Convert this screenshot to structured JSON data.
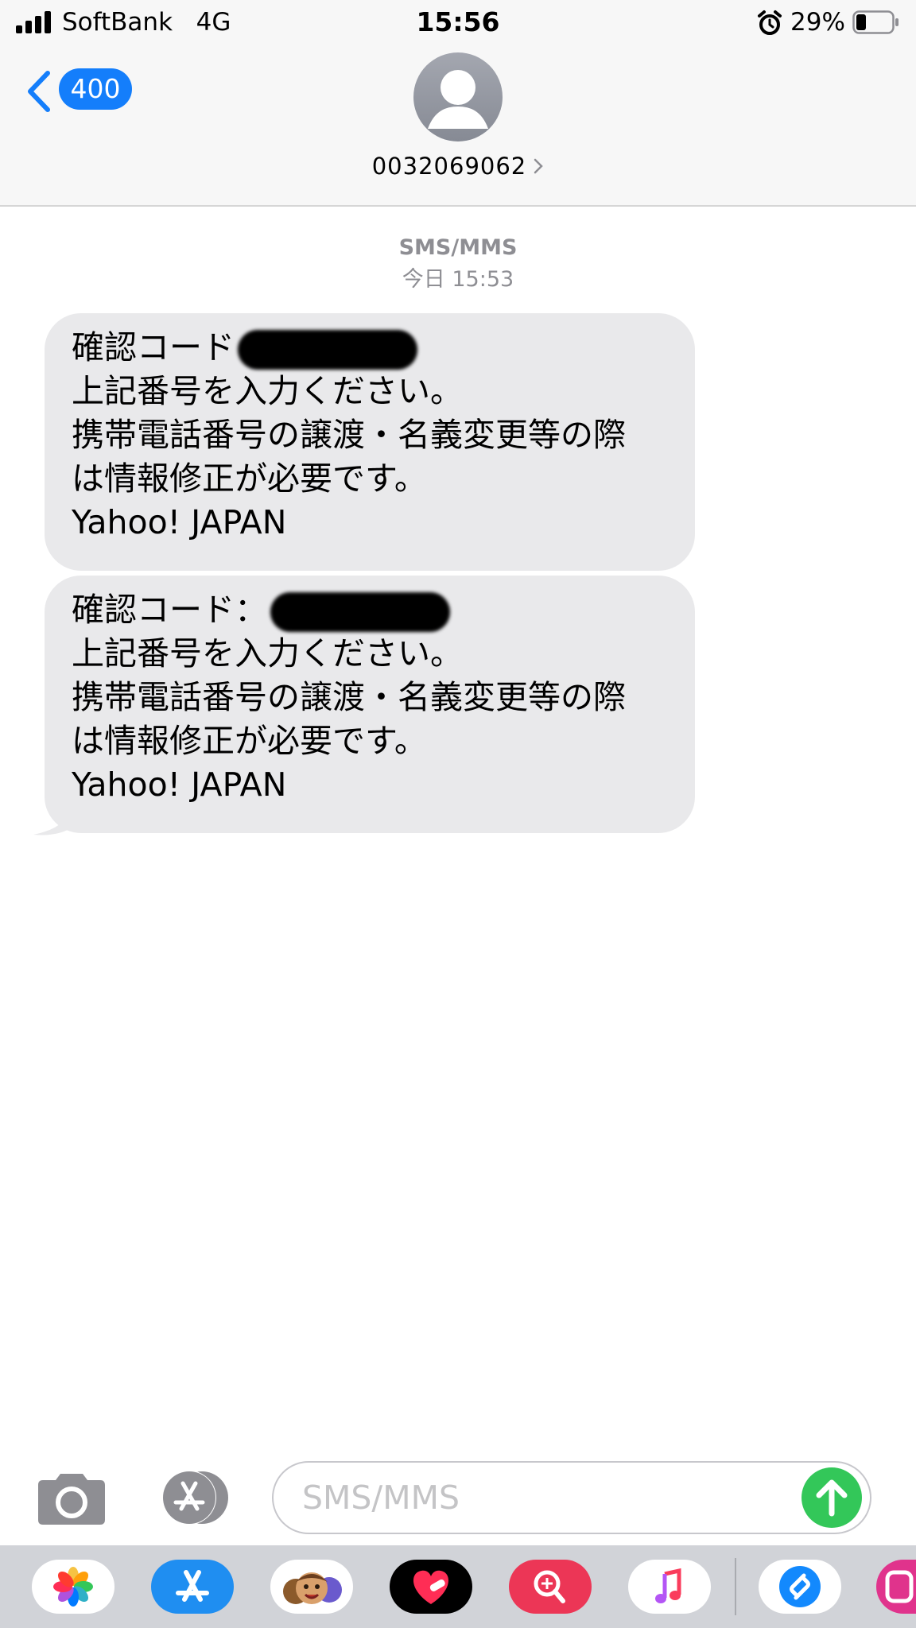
{
  "status_bar": {
    "carrier": "SoftBank",
    "network": "4G",
    "time": "15:56",
    "battery_percent": "29%"
  },
  "nav": {
    "back_count": "400",
    "contact_number": "0032069062"
  },
  "thread": {
    "service": "SMS/MMS",
    "timestamp": "今日 15:53"
  },
  "messages": [
    {
      "code_label": "確認コード",
      "lines": [
        "上記番号を入力ください。",
        "携帯電話番号の譲渡・名義変更等の際",
        "は情報修正が必要です。",
        "Yahoo! JAPAN"
      ]
    },
    {
      "code_label": "確認コード：",
      "lines": [
        "上記番号を入力ください。",
        "携帯電話番号の譲渡・名義変更等の際",
        "は情報修正が必要です。",
        "Yahoo! JAPAN"
      ]
    }
  ],
  "composer": {
    "placeholder": "SMS/MMS"
  },
  "app_drawer": [
    "photos-icon",
    "app-store-icon",
    "memoji-icon",
    "heart-app-icon",
    "search-app-icon",
    "music-icon",
    "shazam-icon",
    "partial-app-icon"
  ],
  "colors": {
    "accent": "#147efb",
    "bubble": "#e9e9eb",
    "send": "#33c759",
    "secondary_text": "#8e8e93"
  }
}
